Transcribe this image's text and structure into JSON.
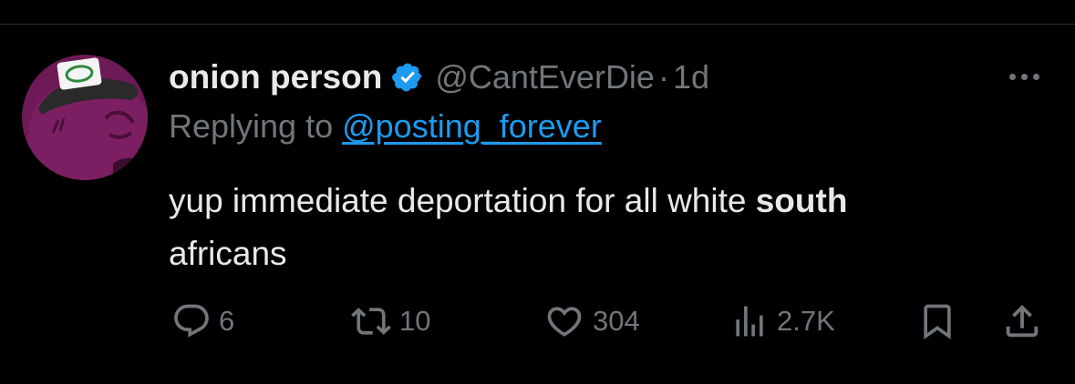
{
  "tweet": {
    "display_name": "onion person",
    "handle": "@CantEverDie",
    "separator": "·",
    "timestamp": "1d",
    "replying_prefix": "Replying to ",
    "replying_to": "@posting_forever",
    "text_main": "yup immediate deportation for all white ",
    "text_bold": "south",
    "text_line2": "africans",
    "verified_icon": "verified-badge-icon",
    "more_icon": "more-options-icon"
  },
  "actions": {
    "reply": {
      "icon": "reply-icon",
      "count": "6"
    },
    "retweet": {
      "icon": "retweet-icon",
      "count": "10"
    },
    "like": {
      "icon": "heart-icon",
      "count": "304"
    },
    "views": {
      "icon": "views-icon",
      "count": "2.7K"
    },
    "bookmark": {
      "icon": "bookmark-icon"
    },
    "share": {
      "icon": "share-icon"
    }
  },
  "colors": {
    "background": "#000000",
    "text": "#e7e9ea",
    "muted": "#71767b",
    "accent": "#1d9bf0",
    "avatar_purple": "#7c1f62"
  }
}
